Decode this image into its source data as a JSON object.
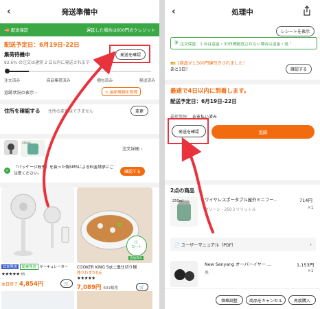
{
  "left": {
    "title": "発送準備中",
    "banner": {
      "left": "配送保証",
      "right": "遅延した場合は600円のクレジット"
    },
    "delivery": {
      "label": "配送予定日：6月19日-22日",
      "status": "集荷待機中",
      "check_button": "発送を確認",
      "sub": "82.6% の注文は通常 2 日以内に発送されます"
    },
    "steps": [
      "注文済み",
      "商品集荷済み",
      "梱包済み",
      "発送済み"
    ],
    "tracking": {
      "link": "追跡状況の表示",
      "latest": "最新情報を取得"
    },
    "address": {
      "title": "住所を確認する",
      "sub": "住所の変更はできません",
      "button": "変更"
    },
    "order_detail": "注文詳細",
    "sms": {
      "text": "『パッケージ紛失』を装った偽SMSによる料金請求にご注意ください。",
      "button": "確認する"
    },
    "products": [
      {
        "badge1": "日本発送",
        "badge2": "関東発送",
        "name": "サーキュレーター",
        "stars": "★★★★★",
        "reviews": "65",
        "price_label": "本日終了",
        "price": "4,854円"
      },
      {
        "name": "COOKER KING 5qt二重仕切り鍋",
        "remain": "残りわずか5点",
        "stars": "★★★★★",
        "price": "7,089円",
        "sold": "601販売",
        "cart_label": "カート",
        "cart_sub": "追加済み"
      }
    ]
  },
  "right": {
    "title": "処理中",
    "receipt_button": "レシートを表示",
    "guarantee": "注文保証：1 合は返金・30日間配送されない場合は返金・送",
    "coupon": {
      "line1": "1商品が1,500円値引きされました！",
      "line2": "あと3日！",
      "button": "確認する"
    },
    "arrival": "最速で4日以内に到着します。",
    "delivery": "配送予定日：6月19日-22日",
    "latest": {
      "label": "最新情報：",
      "value": "お支払い済み"
    },
    "check_button": "発送を確認",
    "track_button": "追跡",
    "items_title": "2点の商品",
    "items": [
      {
        "name": "ワイヤレスポータブル屋外ミニフー...",
        "variant": "グリーン - 250ミリリットル",
        "price": "714円",
        "qty": "×1",
        "img_label": "250ml"
      },
      {
        "name": "New Senyang オーバーイヤー ...",
        "variant": "黒-",
        "price": "1,153円",
        "qty": "×1"
      }
    ],
    "manual": "ユーザーマニュアル（PDF）",
    "footer": [
      "価格調整",
      "商品をキャンセル",
      "再度購入"
    ]
  },
  "colors": {
    "accent": "#f26b0f",
    "green": "#3aa845",
    "red": "#e8323c"
  }
}
